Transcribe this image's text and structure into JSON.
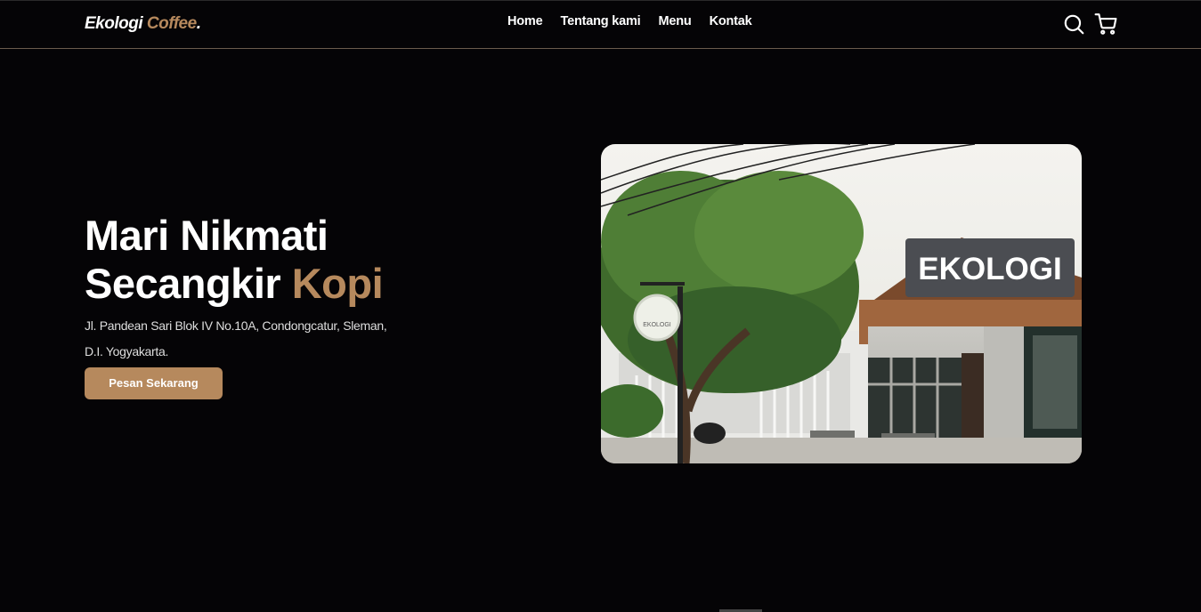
{
  "brand": {
    "name": "Ekologi",
    "accent": "Coffee",
    "dot": "."
  },
  "nav": {
    "items": [
      {
        "label": "Home"
      },
      {
        "label": "Tentang kami"
      },
      {
        "label": "Menu"
      },
      {
        "label": "Kontak"
      }
    ]
  },
  "icons": {
    "search": "search-icon",
    "cart": "shopping-cart-icon"
  },
  "hero": {
    "title_line1": "Mari Nikmati",
    "title_line2_plain": "Secangkir ",
    "title_line2_accent": "Kopi",
    "address": "Jl. Pandean Sari Blok IV No.10A, Condongcatur, Sleman, D.I. Yogyakarta.",
    "cta_label": "Pesan Sekarang",
    "photo_sign_text": "EKOLOGI",
    "photo_round_sign_text": "EKOLOGI"
  },
  "colors": {
    "background": "#050406",
    "accent": "#b6895d",
    "text": "#ffffff"
  }
}
